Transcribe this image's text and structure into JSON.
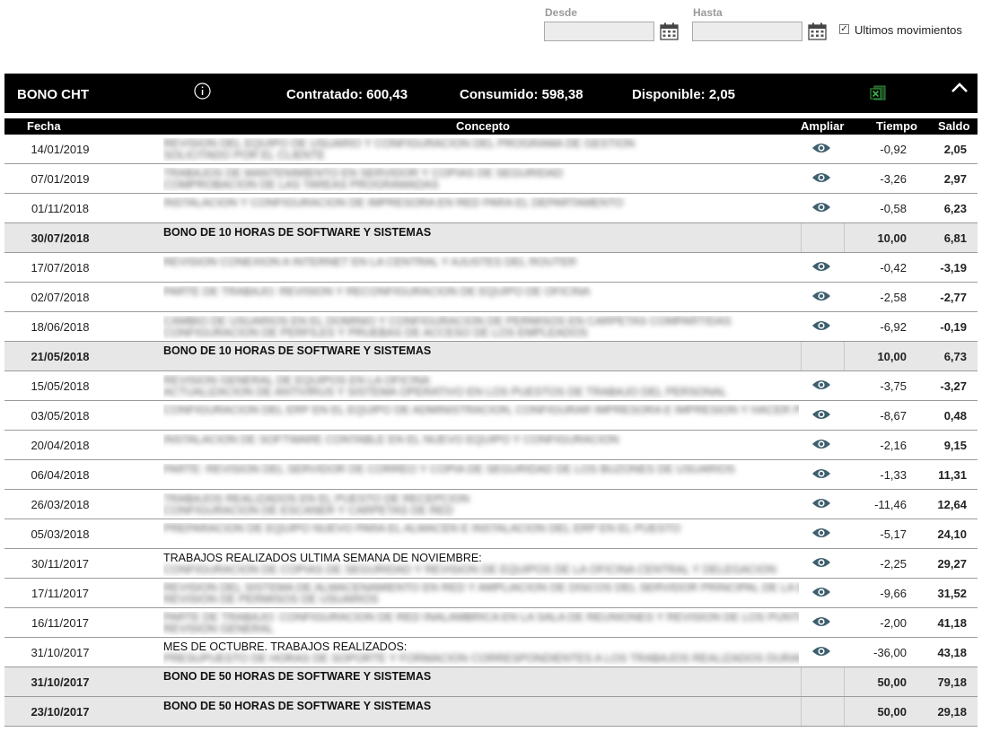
{
  "filter": {
    "desde_label": "Desde",
    "hasta_label": "Hasta",
    "desde_value": "",
    "hasta_value": "",
    "ultimos_label": "Ultimos movimientos",
    "ultimos_checked": true
  },
  "bar": {
    "title": "BONO CHT",
    "contratado": "Contratado: 600,43",
    "consumido": "Consumido: 598,38",
    "disponible": "Disponible: 2,05"
  },
  "columns": {
    "fecha": "Fecha",
    "concepto": "Concepto",
    "ampliar": "Ampliar",
    "tiempo": "Tiempo",
    "saldo": "Saldo"
  },
  "rows": [
    {
      "fecha": "14/01/2019",
      "concepto": "",
      "blur": [
        "REVISION DEL EQUIPO DE USUARIO Y CONFIGURACION DEL PROGRAMA DE GESTION",
        "SOLICITADO POR EL CLIENTE"
      ],
      "eye": true,
      "tiempo": "-0,92",
      "saldo": "2,05",
      "bono": false
    },
    {
      "fecha": "07/01/2019",
      "concepto": "",
      "blur": [
        "TRABAJOS DE MANTENIMIENTO EN SERVIDOR Y COPIAS DE SEGURIDAD",
        "COMPROBACION DE LAS TAREAS PROGRAMADAS"
      ],
      "eye": true,
      "tiempo": "-3,26",
      "saldo": "2,97",
      "bono": false
    },
    {
      "fecha": "01/11/2018",
      "concepto": "",
      "blur": [
        "INSTALACION Y CONFIGURACION DE IMPRESORA EN RED PARA EL DEPARTAMENTO"
      ],
      "eye": true,
      "tiempo": "-0,58",
      "saldo": "6,23",
      "bono": false
    },
    {
      "fecha": "30/07/2018",
      "concepto": "BONO DE 10 HORAS DE SOFTWARE Y SISTEMAS",
      "blur": [],
      "eye": false,
      "tiempo": "10,00",
      "saldo": "6,81",
      "bono": true
    },
    {
      "fecha": "17/07/2018",
      "concepto": "",
      "blur": [
        "REVISION CONEXION A INTERNET EN LA CENTRAL Y AJUSTES DEL ROUTER"
      ],
      "eye": true,
      "tiempo": "-0,42",
      "saldo": "-3,19",
      "bono": false
    },
    {
      "fecha": "02/07/2018",
      "concepto": "",
      "blur": [
        "PARTE DE TRABAJO: REVISION Y RECONFIGURACION DE EQUIPO DE OFICINA"
      ],
      "eye": true,
      "tiempo": "-2,58",
      "saldo": "-2,77",
      "bono": false
    },
    {
      "fecha": "18/06/2018",
      "concepto": "",
      "blur": [
        "CAMBIO DE USUARIOS EN EL DOMINIO Y CONFIGURACION DE PERMISOS EN CARPETAS COMPARTIDAS",
        "CONFIGURACION DE PERFILES Y PRUEBAS DE ACCESO DE LOS EMPLEADOS"
      ],
      "eye": true,
      "tiempo": "-6,92",
      "saldo": "-0,19",
      "bono": false
    },
    {
      "fecha": "21/05/2018",
      "concepto": "BONO DE 10 HORAS DE SOFTWARE Y SISTEMAS",
      "blur": [],
      "eye": false,
      "tiempo": "10,00",
      "saldo": "6,73",
      "bono": true
    },
    {
      "fecha": "15/05/2018",
      "concepto": "",
      "blur": [
        "REVISION GENERAL DE EQUIPOS EN LA OFICINA",
        "ACTUALIZACION DE ANTIVIRUS Y SISTEMA OPERATIVO EN LOS PUESTOS DE TRABAJO DEL PERSONAL"
      ],
      "eye": true,
      "tiempo": "-3,75",
      "saldo": "-3,27",
      "bono": false
    },
    {
      "fecha": "03/05/2018",
      "concepto": "",
      "blur": [
        "CONFIGURACION DEL ERP EN EL EQUIPO DE ADMINISTRACION, CONFIGURAR IMPRESORA E IMPRESION Y HACER PRUEBAS"
      ],
      "eye": true,
      "tiempo": "-8,67",
      "saldo": "0,48",
      "bono": false
    },
    {
      "fecha": "20/04/2018",
      "concepto": "",
      "blur": [
        "INSTALACION DE SOFTWARE CONTABLE EN EL NUEVO EQUIPO Y CONFIGURACION"
      ],
      "eye": true,
      "tiempo": "-2,16",
      "saldo": "9,15",
      "bono": false
    },
    {
      "fecha": "06/04/2018",
      "concepto": "",
      "blur": [
        "PARTE: REVISION DEL SERVIDOR DE CORREO Y COPIA DE SEGURIDAD DE LOS BUZONES DE USUARIOS"
      ],
      "eye": true,
      "tiempo": "-1,33",
      "saldo": "11,31",
      "bono": false
    },
    {
      "fecha": "26/03/2018",
      "concepto": "",
      "blur": [
        "TRABAJOS REALIZADOS EN EL PUESTO DE RECEPCION",
        "CONFIGURACION DE ESCANER Y CARPETAS DE RED"
      ],
      "eye": true,
      "tiempo": "-11,46",
      "saldo": "12,64",
      "bono": false
    },
    {
      "fecha": "05/03/2018",
      "concepto": "",
      "blur": [
        "PREPARACION DE EQUIPO NUEVO PARA EL ALMACEN E INSTALACION DEL ERP EN EL PUESTO"
      ],
      "eye": true,
      "tiempo": "-5,17",
      "saldo": "24,10",
      "bono": false
    },
    {
      "fecha": "30/11/2017",
      "concepto": "TRABAJOS REALIZADOS ÚLTIMA SEMANA DE NOVIEMBRE:",
      "blur": [
        "CONFIGURACION DE COPIAS DE SEGURIDAD Y REVISION DE EQUIPOS DE LA OFICINA CENTRAL Y DELEGACION"
      ],
      "eye": true,
      "tiempo": "-2,25",
      "saldo": "29,27",
      "bono": false
    },
    {
      "fecha": "17/11/2017",
      "concepto": "",
      "blur": [
        "REVISION DEL SISTEMA DE ALMACENAMIENTO EN RED Y AMPLIACION DE DISCOS DEL SERVIDOR PRINCIPAL DE LA EMPRESA",
        "REVISION DE PERMISOS DE USUARIOS"
      ],
      "eye": true,
      "tiempo": "-9,66",
      "saldo": "31,52",
      "bono": false
    },
    {
      "fecha": "16/11/2017",
      "concepto": "",
      "blur": [
        "PARTE DE TRABAJO: CONFIGURACION DE RED INALAMBRICA EN LA SALA DE REUNIONES Y REVISION DE LOS PUNTOS DE ACCESO DE LA OFICINA",
        "REVISION GENERAL"
      ],
      "eye": true,
      "tiempo": "-2,00",
      "saldo": "41,18",
      "bono": false
    },
    {
      "fecha": "31/10/2017",
      "concepto": "MES DE OCTUBRE. TRABAJOS REALIZADOS:",
      "blur": [
        "PRESUPUESTO DE HORAS DE SOPORTE Y FORMACION CORRESPONDIENTES A LOS TRABAJOS REALIZADOS DURANTE EL"
      ],
      "eye": true,
      "tiempo": "-36,00",
      "saldo": "43,18",
      "bono": false
    },
    {
      "fecha": "31/10/2017",
      "concepto": "BONO DE 50 HORAS DE SOFTWARE Y SISTEMAS",
      "blur": [],
      "eye": false,
      "tiempo": "50,00",
      "saldo": "79,18",
      "bono": true
    },
    {
      "fecha": "23/10/2017",
      "concepto": "BONO DE 50 HORAS DE SOFTWARE Y SISTEMAS",
      "blur": [],
      "eye": false,
      "tiempo": "50,00",
      "saldo": "29,18",
      "bono": true
    }
  ],
  "colors": {
    "bar": "#000000",
    "bono_row": "#e7e7e7",
    "eye": "#3d5f6e",
    "excel": "#2e8b3a"
  }
}
